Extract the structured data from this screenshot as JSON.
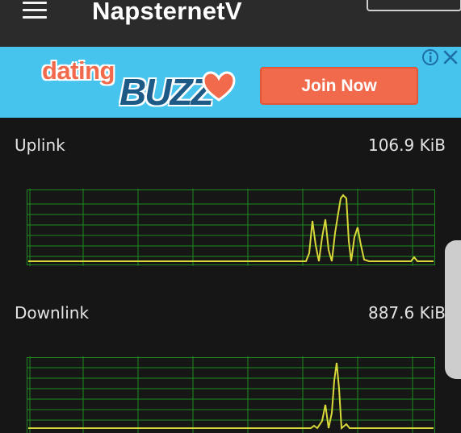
{
  "app": {
    "title": "NapsternetV"
  },
  "ad": {
    "logo_top": "dating",
    "logo_bottom": "BUZZ",
    "cta_label": "Join Now",
    "info_icon": "info-icon",
    "close_icon": "close-icon"
  },
  "uplink": {
    "label": "Uplink",
    "value": "106.9 KiB"
  },
  "downlink": {
    "label": "Downlink",
    "value": "887.6 KiB"
  },
  "colors": {
    "background": "#161616",
    "appbar": "#2b2b2b",
    "ad_background": "#46c4ee",
    "grid": "#1f8a1f",
    "signal": "#d8d83a",
    "cta": "#f06a4b"
  }
}
